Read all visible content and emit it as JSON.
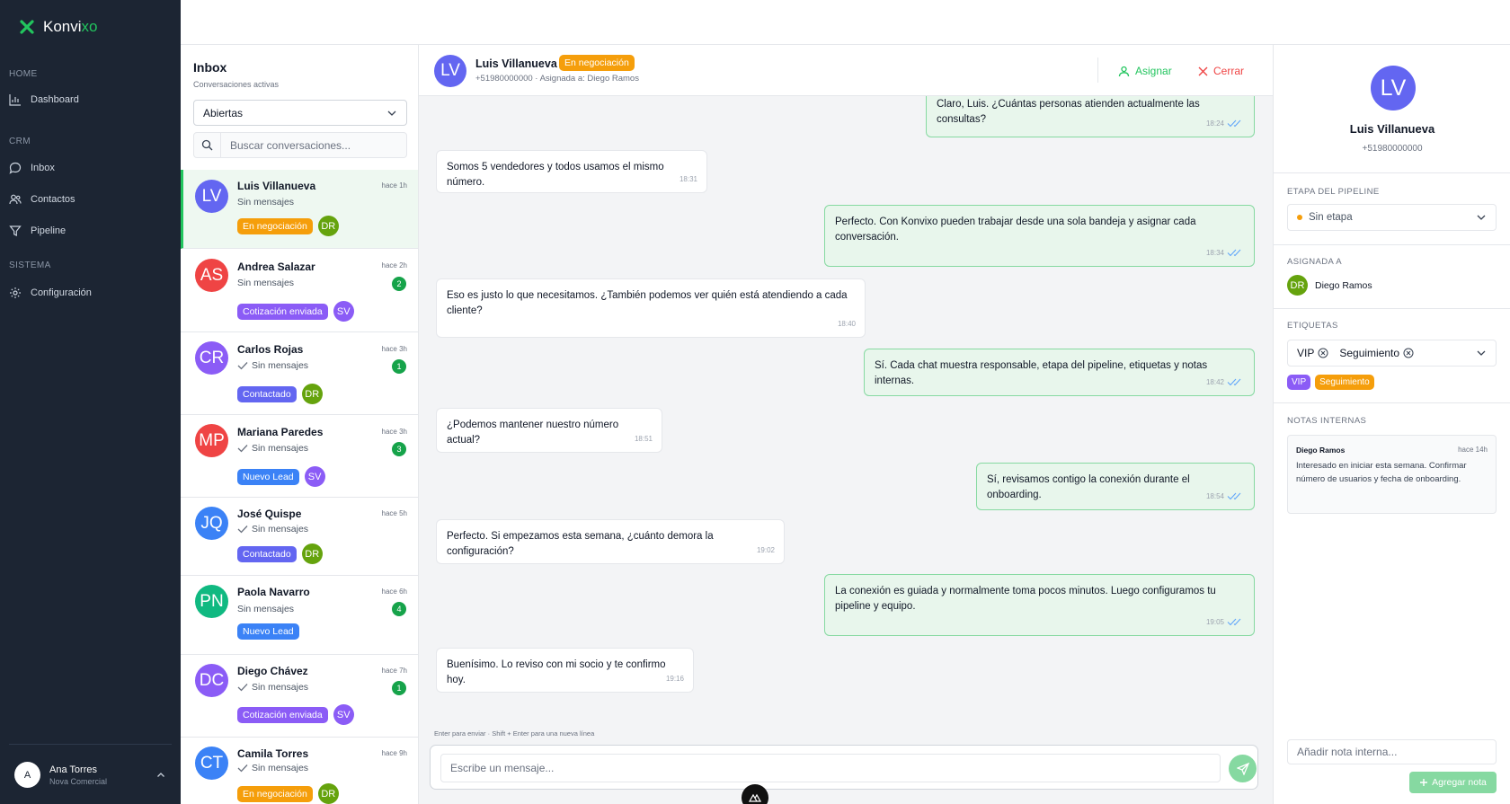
{
  "brand": {
    "name_prefix": "Konvi",
    "name_suffix": "xo"
  },
  "sidebar": {
    "sections": [
      {
        "label": "HOME",
        "items": [
          {
            "label": "Dashboard",
            "icon": "bar-chart-icon"
          }
        ]
      },
      {
        "label": "CRM",
        "items": [
          {
            "label": "Inbox",
            "icon": "inbox-icon"
          },
          {
            "label": "Contactos",
            "icon": "users-icon"
          },
          {
            "label": "Pipeline",
            "icon": "filter-icon"
          }
        ]
      },
      {
        "label": "SISTEMA",
        "items": [
          {
            "label": "Configuración",
            "icon": "gear-icon"
          }
        ]
      }
    ],
    "user": {
      "initial": "A",
      "name": "Ana Torres",
      "org": "Nova Comercial"
    }
  },
  "inbox": {
    "title": "Inbox",
    "subtitle": "Conversaciones activas",
    "filter": "Abiertas",
    "search_placeholder": "Buscar conversaciones...",
    "conversations": [
      {
        "initials": "LV",
        "name": "Luis Villanueva",
        "time": "hace 1h",
        "preview": "Sin mensajes",
        "tag": "En negociación",
        "agent": "DR"
      },
      {
        "initials": "AS",
        "name": "Andrea Salazar",
        "time": "hace 2h",
        "preview": "Sin mensajes",
        "unread": "2",
        "tag": "Cotización enviada",
        "agent": "SV"
      },
      {
        "initials": "CR",
        "name": "Carlos Rojas",
        "time": "hace 3h",
        "preview": "Sin mensajes",
        "unread": "1",
        "tag": "Contactado",
        "agent": "DR"
      },
      {
        "initials": "MP",
        "name": "Mariana Paredes",
        "time": "hace 3h",
        "preview": "Sin mensajes",
        "unread": "3",
        "tag": "Nuevo Lead",
        "agent": "SV"
      },
      {
        "initials": "JQ",
        "name": "José Quispe",
        "time": "hace 5h",
        "preview": "Sin mensajes",
        "tag": "Contactado",
        "agent": "DR"
      },
      {
        "initials": "PN",
        "name": "Paola Navarro",
        "time": "hace 6h",
        "preview": "Sin mensajes",
        "unread": "4",
        "tag": "Nuevo Lead"
      },
      {
        "initials": "DC",
        "name": "Diego Chávez",
        "time": "hace 7h",
        "preview": "Sin mensajes",
        "unread": "1",
        "tag": "Cotización enviada",
        "agent": "SV"
      },
      {
        "initials": "CT",
        "name": "Camila Torres",
        "time": "hace 9h",
        "preview": "Sin mensajes",
        "tag": "En negociación",
        "agent": "DR"
      }
    ]
  },
  "chat": {
    "contact": {
      "initials": "LV",
      "name": "Luis Villanueva",
      "status": "En negociación",
      "meta": "+51980000000 · Asignada a: Diego Ramos"
    },
    "actions": {
      "assign": "Asignar",
      "close": "Cerrar"
    },
    "messages": [
      {
        "dir": "out",
        "text": "Claro, Luis. ¿Cuántas personas atienden actualmente las consultas?",
        "time": "18:24"
      },
      {
        "dir": "in",
        "text": "Somos 5 vendedores y todos usamos el mismo número.",
        "time": "18:31"
      },
      {
        "dir": "out",
        "text": "Perfecto. Con Konvixo pueden trabajar desde una sola bandeja y asignar cada conversación.",
        "time": "18:34"
      },
      {
        "dir": "in",
        "text": "Eso es justo lo que necesitamos. ¿También podemos ver quién está atendiendo a cada cliente?",
        "time": "18:40"
      },
      {
        "dir": "out",
        "text": "Sí. Cada chat muestra responsable, etapa del pipeline, etiquetas y notas internas.",
        "time": "18:42"
      },
      {
        "dir": "in",
        "text": "¿Podemos mantener nuestro número actual?",
        "time": "18:51"
      },
      {
        "dir": "out",
        "text": "Sí, revisamos contigo la conexión durante el onboarding.",
        "time": "18:54"
      },
      {
        "dir": "in",
        "text": "Perfecto. Si empezamos esta semana, ¿cuánto demora la configuración?",
        "time": "19:02"
      },
      {
        "dir": "out",
        "text": "La conexión es guiada y normalmente toma pocos minutos. Luego configuramos tu pipeline y equipo.",
        "time": "19:05"
      },
      {
        "dir": "in",
        "text": "Buenísimo. Lo reviso con mi socio y te confirmo hoy.",
        "time": "19:16"
      }
    ],
    "composer_hint": "Enter para enviar · Shift + Enter para una nueva línea",
    "composer_placeholder": "Escribe un mensaje..."
  },
  "details": {
    "initials": "LV",
    "name": "Luis Villanueva",
    "phone": "+51980000000",
    "pipeline_label": "ETAPA DEL PIPELINE",
    "pipeline_value": "Sin etapa",
    "assigned_label": "ASIGNADA A",
    "assigned_initials": "DR",
    "assigned_name": "Diego Ramos",
    "tags_label": "ETIQUETAS",
    "tags": [
      "VIP",
      "Seguimiento"
    ],
    "notes_label": "NOTAS INTERNAS",
    "note": {
      "author": "Diego Ramos",
      "time": "hace 14h",
      "text": "Interesado en iniciar esta semana. Confirmar número de usuarios y fecha de onboarding."
    },
    "note_placeholder": "Añadir nota interna...",
    "note_button": "Agregar nota"
  },
  "colors": {
    "sidebar": "#1c2533",
    "accent": "#22c55e",
    "tags": {
      "En negociación": "#f59e0b",
      "Cotización enviada": "#8b5cf6",
      "Contactado": "#6366f1",
      "Nuevo Lead": "#3b82f6",
      "VIP": "#8b5cf6",
      "Seguimiento": "#f59e0b"
    },
    "agents": {
      "DR": "#65a30d",
      "SV": "#8b5cf6"
    },
    "avatars": {
      "LV": "#6366f1",
      "AS": "#ef4444",
      "CR": "#8b5cf6",
      "MP": "#ef4444",
      "JQ": "#3b82f6",
      "PN": "#10b981",
      "DC": "#8b5cf6",
      "CT": "#3b82f6"
    }
  }
}
